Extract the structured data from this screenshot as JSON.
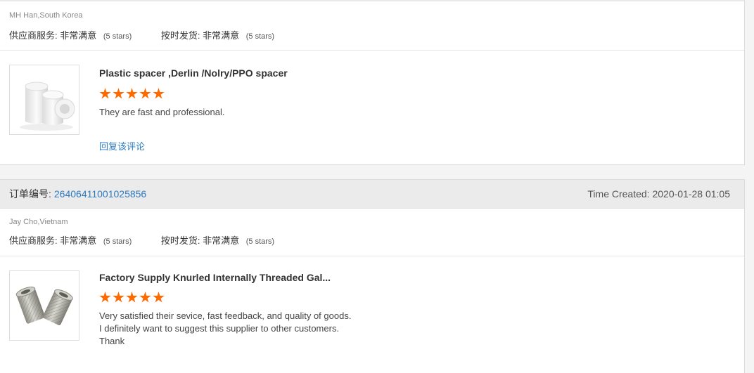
{
  "reviews": [
    {
      "buyer": "MH Han,South Korea",
      "supplier_service": {
        "label": "供应商服务:",
        "value": "非常满意",
        "stars_text": "(5 stars)"
      },
      "on_time": {
        "label": "按时发货:",
        "value": "非常满意",
        "stars_text": "(5 stars)"
      },
      "product_title": "Plastic spacer ,Derlin /Nolry/PPO spacer",
      "rating": 5,
      "text": "They are fast and professional.",
      "reply_label": "回复该评论"
    },
    {
      "order_label": "订单编号:",
      "order_no": "26406411001025856",
      "time_created": "Time Created: 2020-01-28 01:05",
      "buyer": "Jay Cho,Vietnam",
      "supplier_service": {
        "label": "供应商服务:",
        "value": "非常满意",
        "stars_text": "(5 stars)"
      },
      "on_time": {
        "label": "按时发货:",
        "value": "非常满意",
        "stars_text": "(5 stars)"
      },
      "product_title": "Factory Supply Knurled Internally Threaded Gal...",
      "rating": 5,
      "text_lines": [
        "Very satisfied their sevice, fast feedback, and quality of goods.",
        "I definitely want to suggest this supplier to other customers.",
        "Thank"
      ]
    }
  ],
  "colors": {
    "star": "#ff6a00",
    "link": "#2d7bc0"
  }
}
